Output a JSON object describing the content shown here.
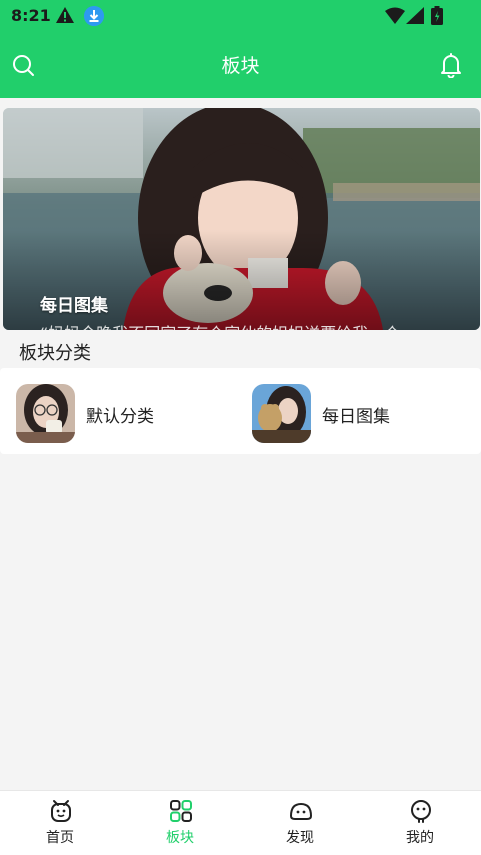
{
  "status_bar": {
    "time": "8:21"
  },
  "header": {
    "title": "板块"
  },
  "banner": {
    "title": "每日图集",
    "subtitle": "“妈妈今晚我不回家了有个家伙的姐姐送要给我一个"
  },
  "section": {
    "title": "板块分类"
  },
  "categories": [
    {
      "label": "默认分类"
    },
    {
      "label": "每日图集"
    }
  ],
  "bottom_nav": [
    {
      "label": "首页",
      "icon": "home-icon"
    },
    {
      "label": "板块",
      "icon": "grid-icon",
      "active": true
    },
    {
      "label": "发现",
      "icon": "discover-icon"
    },
    {
      "label": "我的",
      "icon": "profile-icon"
    }
  ],
  "colors": {
    "accent": "#21cf6b",
    "background": "#f4f4f4"
  }
}
